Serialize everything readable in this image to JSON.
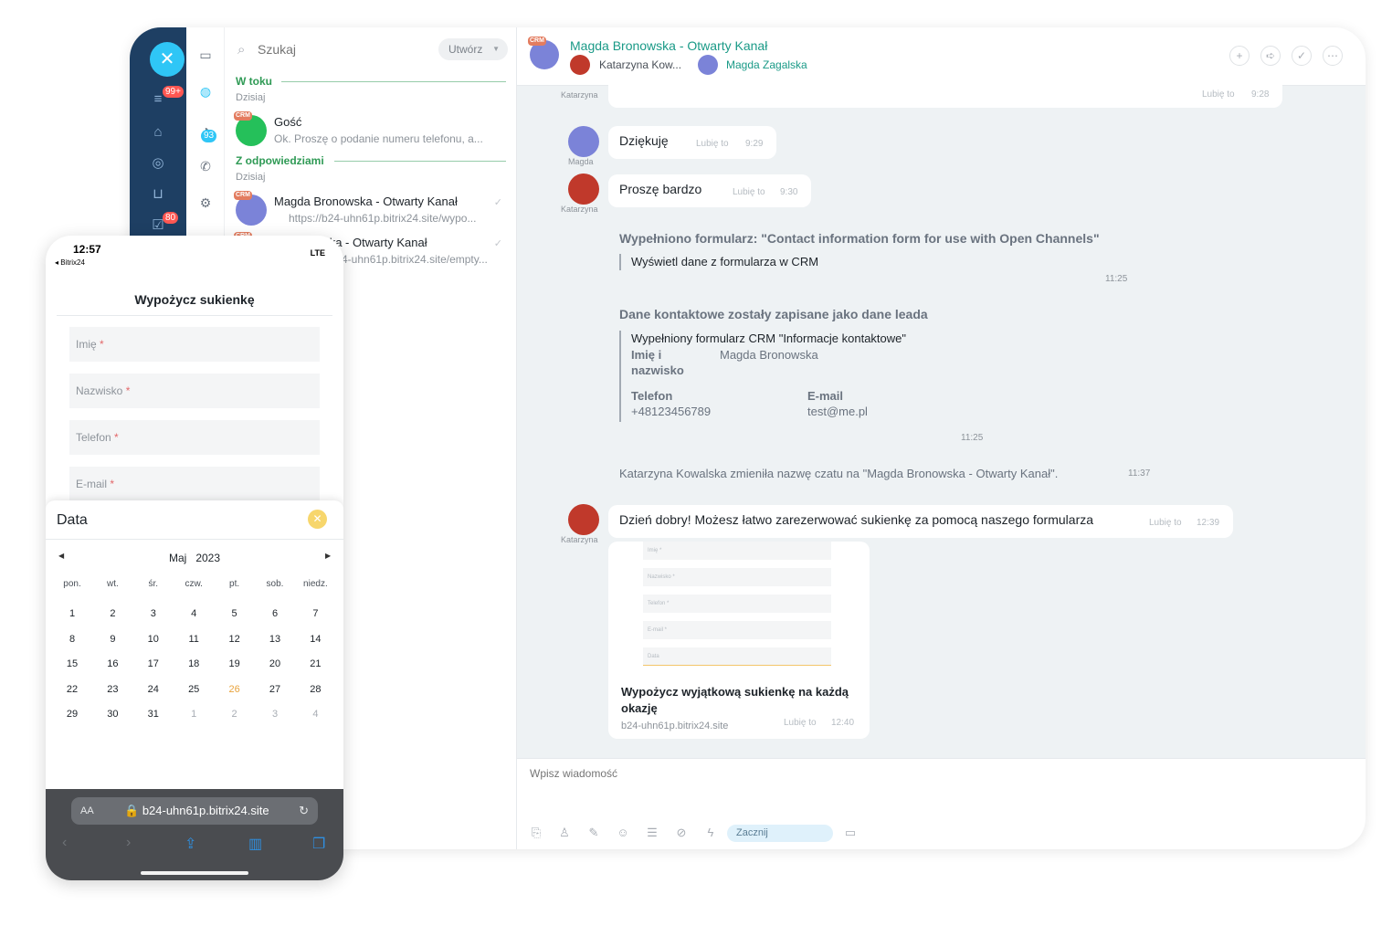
{
  "colors": {
    "accent": "#2fc6f6",
    "green": "#2f9a55",
    "teal": "#1a9a87",
    "badge_red": "#ff5752"
  },
  "leftbar": {
    "badges": [
      "99+",
      "80"
    ],
    "icons": [
      "filter-icon",
      "bank-icon",
      "target-icon",
      "cart-icon",
      "tasks-icon"
    ]
  },
  "iconbar": {
    "badge": "93"
  },
  "recent": {
    "search_placeholder": "Szukaj",
    "create_label": "Utwórz",
    "sections": [
      {
        "title": "W toku",
        "date": "Dzisiaj"
      },
      {
        "title": "Z odpowiedziami",
        "date": "Dzisiaj"
      }
    ],
    "crm_tag": "CRM",
    "items": [
      {
        "name": "Gość",
        "sub": "Ok. Proszę o podanie numeru telefonu, a..."
      },
      {
        "name": "Magda Bronowska - Otwarty Kanał",
        "sub": "https://b24-uhn61p.bitrix24.site/wypo..."
      },
      {
        "name": "...a Zagalska - Otwarty Kanał",
        "sub": "4-uhn61p.bitrix24.site/empty..."
      }
    ]
  },
  "chat": {
    "title": "Magda Bronowska - Otwarty Kanał",
    "member1": "Katarzyna Kow...",
    "member2": "Magda Zagalska",
    "like": "Lubię to",
    "messages": {
      "m0_time": "9:28",
      "m0_author": "Katarzyna",
      "m1_text": "Dziękuję",
      "m1_time": "9:29",
      "m1_author": "Magda",
      "m2_text": "Proszę bardzo",
      "m2_time": "9:30",
      "m2_author": "Katarzyna",
      "form_title": "Wypełniono formularz: \"Contact information form for use with Open Channels\"",
      "form_link": "Wyświetl dane z formularza w CRM",
      "form_time": "11:25",
      "lead_title": "Dane kontaktowe zostały zapisane jako dane leada",
      "lead_sub": "Wypełniony formularz CRM \"Informacje kontaktowe\"",
      "name_label_1": "Imię i",
      "name_label_2": "nazwisko",
      "name_value": "Magda Bronowska",
      "phone_label": "Telefon",
      "phone_value": "+48123456789",
      "email_label": "E-mail",
      "email_value": "test@me.pl",
      "lead_time": "11:25",
      "rename_text": "Katarzyna Kowalska zmieniła nazwę czatu na \"Magda Bronowska - Otwarty Kanał\".",
      "rename_time": "11:37",
      "m3_text": "Dzień dobry! Możesz łatwo zarezerwować sukienkę za pomocą naszego formularza",
      "m3_time": "12:39",
      "m3_author": "Katarzyna",
      "preview_fields": [
        "Imię *",
        "Nazwisko *",
        "Telefon *",
        "E-mail *",
        "Data"
      ],
      "preview_title": "Wypożycz wyjątkową sukienkę na każdą okazję",
      "preview_site": "b24-uhn61p.bitrix24.site",
      "preview_time": "12:40"
    },
    "compose_placeholder": "Wpisz wiadomość",
    "start_label": "Zacznij"
  },
  "phone": {
    "time": "12:57",
    "back": "◂ Bitrix24",
    "network": "LTE",
    "title": "Wypożycz sukienkę",
    "fields": [
      "Imię",
      "Nazwisko",
      "Telefon",
      "E-mail"
    ],
    "required_mark": "*",
    "date_title": "Data",
    "month": "Maj",
    "year": "2023",
    "dows": [
      "pon.",
      "wt.",
      "śr.",
      "czw.",
      "pt.",
      "sob.",
      "niedz."
    ],
    "weeks": [
      [
        "1",
        "2",
        "3",
        "4",
        "5",
        "6",
        "7"
      ],
      [
        "8",
        "9",
        "10",
        "11",
        "12",
        "13",
        "14"
      ],
      [
        "15",
        "16",
        "17",
        "18",
        "19",
        "20",
        "21"
      ],
      [
        "22",
        "23",
        "24",
        "25",
        "26",
        "27",
        "28"
      ],
      [
        "29",
        "30",
        "31",
        "1",
        "2",
        "3",
        "4"
      ]
    ],
    "url_aa": "AA",
    "url": "b24-uhn61p.bitrix24.site"
  }
}
